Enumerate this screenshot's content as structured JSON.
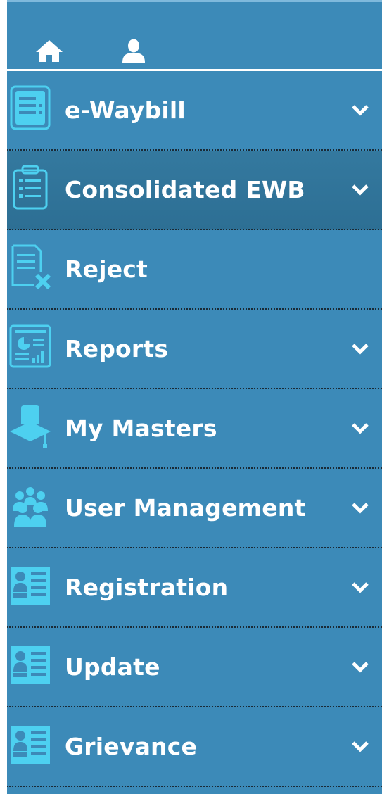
{
  "colors": {
    "sidebar_bg": "#3c8ab8",
    "active_bg": "#2d6f94",
    "icon": "#4dd0f0",
    "text": "#ffffff"
  },
  "header": {
    "icons": [
      "home-icon",
      "user-icon"
    ]
  },
  "menu": {
    "items": [
      {
        "label": "e-Waybill",
        "icon": "document-list-icon",
        "expandable": true
      },
      {
        "label": "Consolidated EWB",
        "icon": "clipboard-list-icon",
        "expandable": true,
        "active": true
      },
      {
        "label": "Reject",
        "icon": "document-reject-icon",
        "expandable": false
      },
      {
        "label": "Reports",
        "icon": "report-chart-icon",
        "expandable": true
      },
      {
        "label": "My Masters",
        "icon": "graduation-cap-icon",
        "expandable": true
      },
      {
        "label": "User Management",
        "icon": "users-group-icon",
        "expandable": true
      },
      {
        "label": "Registration",
        "icon": "id-card-icon",
        "expandable": true
      },
      {
        "label": "Update",
        "icon": "id-card-icon",
        "expandable": true
      },
      {
        "label": "Grievance",
        "icon": "id-card-icon",
        "expandable": true
      }
    ]
  }
}
